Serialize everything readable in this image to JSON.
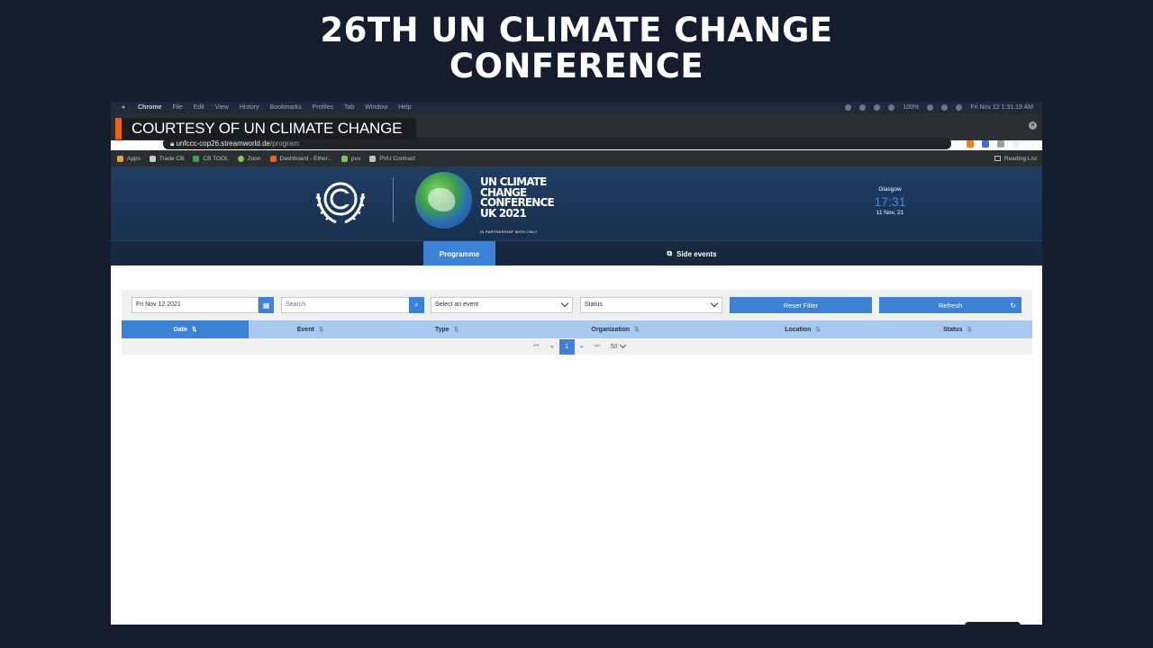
{
  "headline": {
    "line1": "26TH UN CLIMATE CHANGE",
    "line2": "CONFERENCE"
  },
  "menubar": {
    "items": [
      "Chrome",
      "File",
      "Edit",
      "View",
      "History",
      "Bookmarks",
      "Profiles",
      "Tab",
      "Window",
      "Help"
    ],
    "battery": "100%",
    "clock": "Fri Nov 12  1:31:19 AM"
  },
  "overlay": {
    "courtesy": "COURTESY OF UN CLIMATE CHANGE"
  },
  "browser": {
    "url_host": "unfccc-cop26.streamworld.de",
    "url_path": "/program",
    "bookmarks": [
      {
        "label": "Apps",
        "icon": "apps-grid-icon",
        "color": "#e8a33b"
      },
      {
        "label": "Trade CB",
        "icon": "tradecb-icon",
        "color": "#c9c9c9"
      },
      {
        "label": "CB TOOL",
        "icon": "cbtool-icon",
        "color": "#3fa34a"
      },
      {
        "label": "Zoon",
        "icon": "zoon-icon",
        "color": "#8bc34a"
      },
      {
        "label": "Dashboard - Ether...",
        "icon": "dashboard-icon",
        "color": "#e8641a"
      },
      {
        "label": "pvu",
        "icon": "pvu-icon",
        "color": "#6fcf3a"
      },
      {
        "label": "PVU Contract",
        "icon": "contract-icon",
        "color": "#bdc1c6"
      }
    ],
    "reading_list": "Reading List"
  },
  "site": {
    "cop_title_lines": [
      "UN CLIMATE",
      "CHANGE",
      "CONFERENCE",
      "UK 2021"
    ],
    "cop_subtitle": "IN PARTNERSHIP WITH ITALY",
    "clock_city": "Glasgow",
    "clock_time": "17:31",
    "clock_date": "11 Nov, 21",
    "tabs": {
      "programme": "Programme",
      "side_events": "Side events"
    }
  },
  "filters": {
    "date_value": "Fri Nov 12 2021",
    "search_placeholder": "Search",
    "event_select": "Select an event",
    "status_select": "Status",
    "reset_label": "Reset Filter",
    "refresh_label": "Refresh"
  },
  "table": {
    "columns": [
      "Date",
      "Event",
      "Type",
      "Organization",
      "Location",
      "Status"
    ],
    "sorted_column": "Date"
  },
  "pagination": {
    "current_page": "1",
    "page_size": "50"
  },
  "colors": {
    "accent": "#3b82d6",
    "header_bg": "#1f3d63",
    "table_header": "#a8c8ee",
    "courtesy_bar": "#e8641a"
  }
}
